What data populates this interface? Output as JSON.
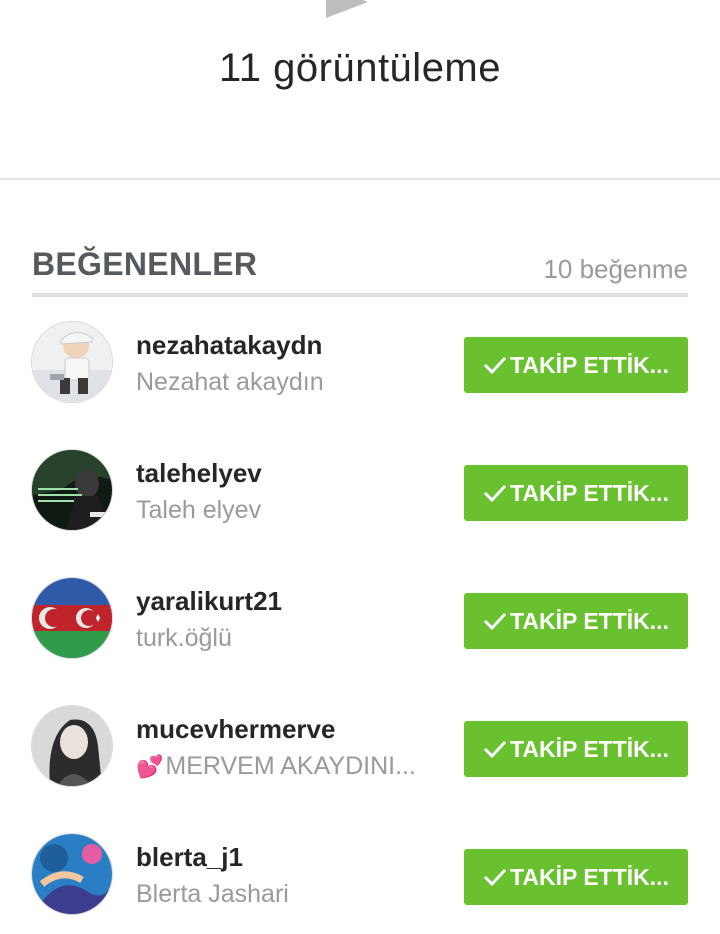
{
  "video": {
    "views_label": "11 görüntüleme"
  },
  "likers": {
    "title": "BEĞENENLER",
    "count_label": "10 beğenme",
    "follow_button_label": "TAKİP ETTİK...",
    "items": [
      {
        "username": "nezahatakaydn",
        "full_name": "Nezahat akaydın"
      },
      {
        "username": "talehelyev",
        "full_name": "Taleh elyev"
      },
      {
        "username": "yaralikurt21",
        "full_name": "turk.öğlü"
      },
      {
        "username": "mucevhermerve",
        "full_name_prefix_icon": "two-hearts-icon",
        "full_name": "MERVEM AKAYDINI..."
      },
      {
        "username": "blerta_j1",
        "full_name": "Blerta Jashari"
      }
    ]
  },
  "colors": {
    "follow_green": "#6ac12f",
    "username_text": "#262626",
    "secondary_text": "#9a9a9a",
    "header_text": "#555a5e"
  }
}
